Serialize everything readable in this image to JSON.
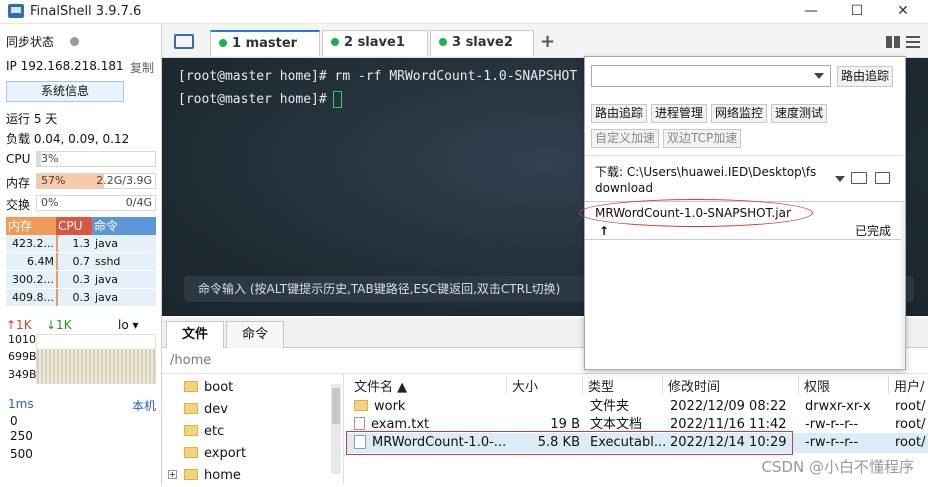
{
  "titlebar": {
    "title": "FinalShell 3.9.7.6",
    "minimize": "—",
    "maximize": "☐",
    "close": "✕"
  },
  "left": {
    "sync_label": "同步状态",
    "ip_label": "IP 192.168.218.181",
    "copy_label": "复制",
    "sysinfo_button": "系统信息",
    "uptime": "运行 5 天",
    "load": "负载 0.04, 0.09, 0.12",
    "cpu": {
      "label": "CPU",
      "pct": "3%",
      "value": 0.03
    },
    "mem": {
      "label": "内存",
      "pct": "57%",
      "amount": "2.2G/3.9G",
      "value": 0.57
    },
    "swap": {
      "label": "交换",
      "pct": "0%",
      "amount": "0/4G",
      "value": 0.0
    },
    "proc_headers": [
      "内存",
      "CPU",
      "命令"
    ],
    "processes": [
      {
        "mem": "423.2...",
        "cpu": "1.3",
        "cmd": "java"
      },
      {
        "mem": "6.4M",
        "cpu": "0.7",
        "cmd": "sshd"
      },
      {
        "mem": "300.2...",
        "cpu": "0.3",
        "cmd": "java"
      },
      {
        "mem": "409.8...",
        "cpu": "0.3",
        "cmd": "java"
      }
    ],
    "net": {
      "up": "↑1K",
      "down": "↓1K",
      "iface": "lo ▾",
      "ticks": [
        "1010B",
        "699B",
        "349B"
      ]
    },
    "ping": {
      "label": "1ms",
      "host": "本机",
      "ticks": [
        "0",
        "250",
        "500"
      ]
    }
  },
  "tabs": [
    {
      "label": "1 master",
      "active": true
    },
    {
      "label": "2 slave1",
      "active": false
    },
    {
      "label": "3 slave2",
      "active": false
    }
  ],
  "add_tab": "+",
  "terminal": {
    "line1": "[root@master home]# rm -rf MRWordCount-1.0-SNAPSHOT",
    "line2": "[root@master home]#",
    "cmd_hint": "命令输入 (按ALT键提示历史,TAB键路径,ESC键返回,双击CTRL切换)"
  },
  "bottom_tabs": [
    "文件",
    "命令"
  ],
  "path": "/home",
  "tree": [
    "boot",
    "dev",
    "etc",
    "export",
    "home"
  ],
  "file_headers": {
    "name": "文件名 ▲",
    "size": "大小",
    "type": "类型",
    "mtime": "修改时间",
    "perm": "权限",
    "owner": "用户/"
  },
  "files": [
    {
      "name": "work",
      "size": "",
      "type": "文件夹",
      "mtime": "2022/12/09 08:22",
      "perm": "drwxr-xr-x",
      "owner": "root/"
    },
    {
      "name": "exam.txt",
      "size": "19 B",
      "type": "文本文档",
      "mtime": "2022/11/16 11:42",
      "perm": "-rw-r--r--",
      "owner": "root/"
    },
    {
      "name": "MRWordCount-1.0-...",
      "size": "5.8 KB",
      "type": "Executabl...",
      "mtime": "2022/12/14 10:29",
      "perm": "-rw-r--r--",
      "owner": "root/"
    }
  ],
  "popup": {
    "route_button": "路由追踪",
    "tools": [
      "路由追踪",
      "进程管理",
      "网络监控",
      "速度测试"
    ],
    "tools2": [
      "自定义加速",
      "双边TCP加速"
    ],
    "download_label": "下载: C:\\Users\\huawei.IED\\Desktop\\fs",
    "download_label2": "download",
    "download_file": "MRWordCount-1.0-SNAPSHOT.jar",
    "download_status": "已完成",
    "download_arrow": "↑"
  },
  "watermark": "CSDN @小白不懂程序",
  "colors": {
    "accent": "#1e7be0",
    "mem_fill": "#f7c9a6",
    "proc_mem": "#f09b58",
    "proc_cpu": "#d9573f",
    "proc_cmd": "#5d96d6",
    "online": "#19b449"
  }
}
